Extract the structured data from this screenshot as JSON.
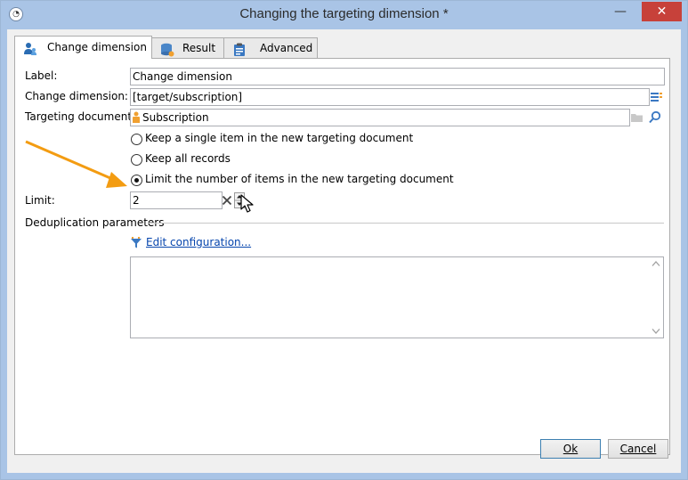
{
  "window": {
    "title": "Changing the targeting dimension *",
    "close_glyph": "✕",
    "min_glyph": "—",
    "max_glyph": "☐"
  },
  "tabs": [
    {
      "label": "Change dimension",
      "icon": "user-dimension-icon",
      "active": true
    },
    {
      "label": "Result",
      "icon": "database-gear-icon",
      "active": false
    },
    {
      "label": "Advanced",
      "icon": "clipboard-icon",
      "active": false
    }
  ],
  "form": {
    "label_label": "Label:",
    "label_value": "Change dimension",
    "change_dimension_label": "Change dimension:",
    "change_dimension_value": "[target/subscription]",
    "targeting_document_label": "Targeting document:",
    "targeting_document_value": "Subscription",
    "options": [
      {
        "label": "Keep a single item in the new targeting document",
        "checked": false
      },
      {
        "label": "Keep all records",
        "checked": false
      },
      {
        "label": "Limit the number of items in the new targeting document",
        "checked": true
      }
    ],
    "limit_label": "Limit:",
    "limit_value": "2",
    "dedup_label": "Deduplication parameters",
    "edit_link": "Edit configuration..."
  },
  "buttons": {
    "ok": "Ok",
    "cancel": "Cancel"
  },
  "colors": {
    "titlebar": "#a9c4e6",
    "close": "#c7413a",
    "annotation_arrow": "#f39c12",
    "link": "#0645ad"
  }
}
